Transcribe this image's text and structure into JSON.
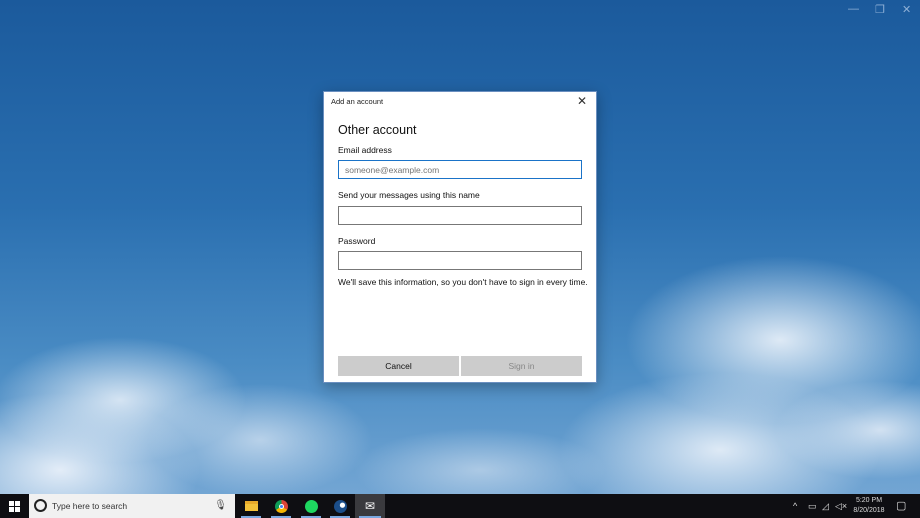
{
  "window_controls": {
    "minimize": "—",
    "restore": "❐",
    "close": "✕"
  },
  "dialog": {
    "title": "Add an account",
    "close": "✕",
    "heading": "Other account",
    "email_label": "Email address",
    "email_placeholder": "someone@example.com",
    "name_label": "Send your messages using this name",
    "password_label": "Password",
    "note": "We'll save this information, so you don't have to sign in every time.",
    "cancel": "Cancel",
    "sign_in": "Sign in"
  },
  "taskbar": {
    "search_placeholder": "Type here to search",
    "apps": [
      "file-explorer",
      "chrome",
      "spotify",
      "steam",
      "mail"
    ],
    "time": "5:20 PM",
    "date": "8/20/2018"
  }
}
